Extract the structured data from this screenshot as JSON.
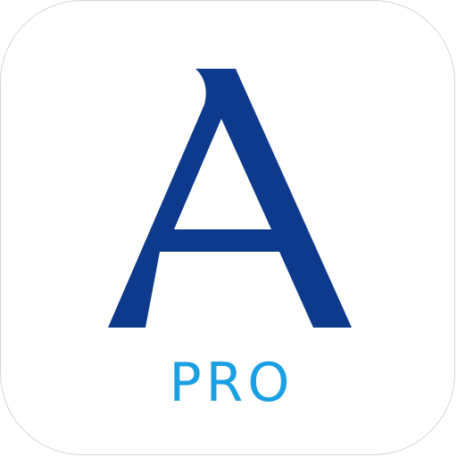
{
  "app_icon": {
    "logo_icon": "serif-letter-a-icon",
    "label": "PRO",
    "colors": {
      "letter_mark": "#0d3a8c",
      "label": "#1aa0e3",
      "background": "#ffffff",
      "border": "#d6d6d6"
    }
  }
}
